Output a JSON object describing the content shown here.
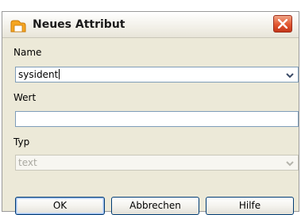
{
  "dialog": {
    "title": "Neues Attribut",
    "icon": "folder-icon"
  },
  "fields": {
    "name": {
      "label": "Name",
      "value": "sysident"
    },
    "wert": {
      "label": "Wert",
      "value": ""
    },
    "typ": {
      "label": "Typ",
      "value": "text",
      "disabled": true
    }
  },
  "buttons": {
    "ok": "OK",
    "cancel": "Abbrechen",
    "help": "Hilfe"
  },
  "colors": {
    "close_button": "#e2562f",
    "icon": "#f0a020",
    "field_border": "#7f9db9"
  }
}
